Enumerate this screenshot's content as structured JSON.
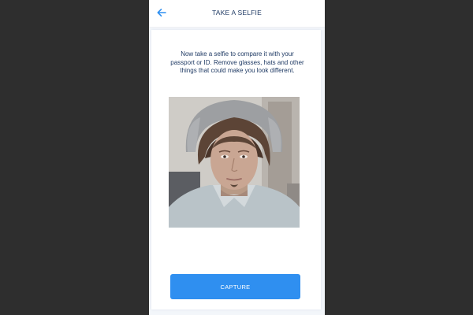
{
  "header": {
    "back_icon": "arrow-left-icon",
    "title": "TAKE A SELFIE"
  },
  "main": {
    "instructions": "Now take a selfie to compare it with your passport or ID. Remove glasses, hats and other things that could make you look different.",
    "camera_preview": "selfie-camera-preview",
    "capture_label": "CAPTURE"
  },
  "colors": {
    "background": "#2e2e2e",
    "primary": "#2f8ff0",
    "text": "#1f3a64",
    "surface": "#ffffff"
  }
}
